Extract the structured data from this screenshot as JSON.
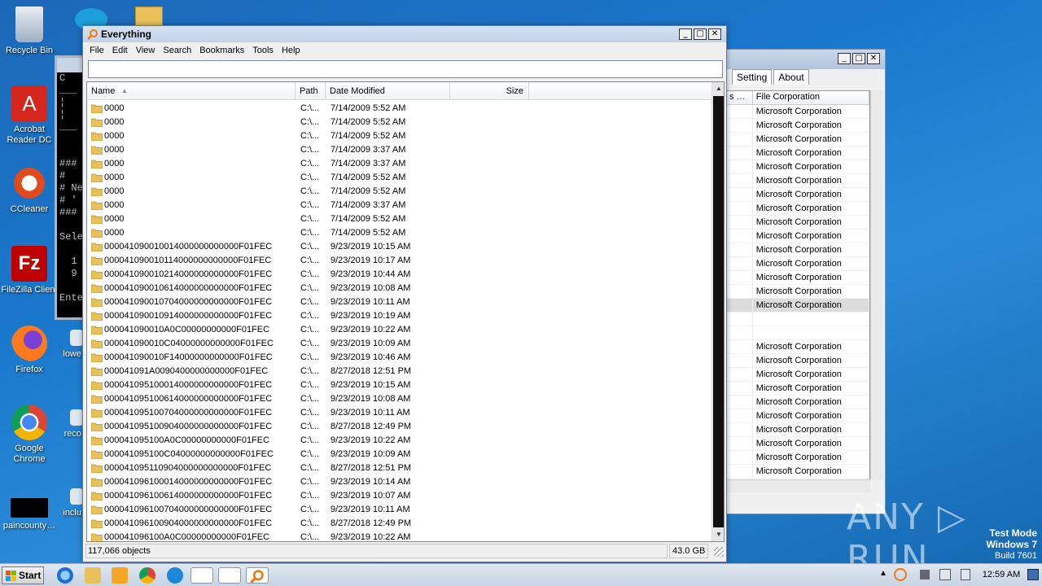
{
  "desktop": {
    "icons": [
      {
        "label": "Recycle Bin"
      },
      {
        "label": "Acrobat Reader DC"
      },
      {
        "label": "CCleaner"
      },
      {
        "label": "FileZilla Client"
      },
      {
        "label": "Firefox"
      },
      {
        "label": "Google Chrome"
      },
      {
        "label": "paincounty…"
      },
      {
        "label": "lowe"
      },
      {
        "label": "reco"
      },
      {
        "label": "inclu"
      }
    ]
  },
  "console": {
    "lines": [
      "C",
      "___",
      "¦",
      "¦",
      "___",
      "",
      "",
      "###",
      "#",
      "# Ne",
      "# '",
      "###",
      "",
      "Sele",
      "",
      "  1",
      "  9",
      "",
      "Ente"
    ]
  },
  "process_window": {
    "tabs": [
      "Setting",
      "About"
    ],
    "header": [
      "s …",
      "File Corporation"
    ],
    "rows_top": [
      "Microsoft Corporation",
      "Microsoft Corporation",
      "Microsoft Corporation",
      "Microsoft Corporation",
      "Microsoft Corporation",
      "Microsoft Corporation",
      "Microsoft Corporation",
      "Microsoft Corporation",
      "Microsoft Corporation",
      "Microsoft Corporation",
      "Microsoft Corporation",
      "Microsoft Corporation",
      "Microsoft Corporation",
      "Microsoft Corporation",
      "Microsoft Corporation"
    ],
    "rows_bottom": [
      "Microsoft Corporation",
      "Microsoft Corporation",
      "Microsoft Corporation",
      "Microsoft Corporation",
      "Microsoft Corporation",
      "Microsoft Corporation",
      "Microsoft Corporation",
      "Microsoft Corporation",
      "Microsoft Corporation",
      "Microsoft Corporation"
    ]
  },
  "everything": {
    "title": "Everything",
    "menu": [
      "File",
      "Edit",
      "View",
      "Search",
      "Bookmarks",
      "Tools",
      "Help"
    ],
    "search_value": "",
    "columns": {
      "name": "Name",
      "path": "Path",
      "date": "Date Modified",
      "size": "Size"
    },
    "rows": [
      {
        "name": "0000",
        "path": "C:\\...",
        "date": "7/14/2009 5:52 AM"
      },
      {
        "name": "0000",
        "path": "C:\\...",
        "date": "7/14/2009 5:52 AM"
      },
      {
        "name": "0000",
        "path": "C:\\...",
        "date": "7/14/2009 5:52 AM"
      },
      {
        "name": "0000",
        "path": "C:\\...",
        "date": "7/14/2009 3:37 AM"
      },
      {
        "name": "0000",
        "path": "C:\\...",
        "date": "7/14/2009 3:37 AM"
      },
      {
        "name": "0000",
        "path": "C:\\...",
        "date": "7/14/2009 5:52 AM"
      },
      {
        "name": "0000",
        "path": "C:\\...",
        "date": "7/14/2009 5:52 AM"
      },
      {
        "name": "0000",
        "path": "C:\\...",
        "date": "7/14/2009 3:37 AM"
      },
      {
        "name": "0000",
        "path": "C:\\...",
        "date": "7/14/2009 5:52 AM"
      },
      {
        "name": "0000",
        "path": "C:\\...",
        "date": "7/14/2009 5:52 AM"
      },
      {
        "name": "000041090010014000000000000F01FEC",
        "path": "C:\\...",
        "date": "9/23/2019 10:15 AM"
      },
      {
        "name": "000041090010114000000000000F01FEC",
        "path": "C:\\...",
        "date": "9/23/2019 10:17 AM"
      },
      {
        "name": "000041090010214000000000000F01FEC",
        "path": "C:\\...",
        "date": "9/23/2019 10:44 AM"
      },
      {
        "name": "000041090010614000000000000F01FEC",
        "path": "C:\\...",
        "date": "9/23/2019 10:08 AM"
      },
      {
        "name": "000041090010704000000000000F01FEC",
        "path": "C:\\...",
        "date": "9/23/2019 10:11 AM"
      },
      {
        "name": "000041090010914000000000000F01FEC",
        "path": "C:\\...",
        "date": "9/23/2019 10:19 AM"
      },
      {
        "name": "000041090010A0C00000000000F01FEC",
        "path": "C:\\...",
        "date": "9/23/2019 10:22 AM"
      },
      {
        "name": "000041090010C04000000000000F01FEC",
        "path": "C:\\...",
        "date": "9/23/2019 10:09 AM"
      },
      {
        "name": "000041090010F14000000000000F01FEC",
        "path": "C:\\...",
        "date": "9/23/2019 10:46 AM"
      },
      {
        "name": "000041091A0090400000000000F01FEC",
        "path": "C:\\...",
        "date": "8/27/2018 12:51 PM"
      },
      {
        "name": "000041095100014000000000000F01FEC",
        "path": "C:\\...",
        "date": "9/23/2019 10:15 AM"
      },
      {
        "name": "000041095100614000000000000F01FEC",
        "path": "C:\\...",
        "date": "9/23/2019 10:08 AM"
      },
      {
        "name": "000041095100704000000000000F01FEC",
        "path": "C:\\...",
        "date": "9/23/2019 10:11 AM"
      },
      {
        "name": "000041095100904000000000000F01FEC",
        "path": "C:\\...",
        "date": "8/27/2018 12:49 PM"
      },
      {
        "name": "000041095100A0C00000000000F01FEC",
        "path": "C:\\...",
        "date": "9/23/2019 10:22 AM"
      },
      {
        "name": "000041095100C04000000000000F01FEC",
        "path": "C:\\...",
        "date": "9/23/2019 10:09 AM"
      },
      {
        "name": "000041095110904000000000000F01FEC",
        "path": "C:\\...",
        "date": "8/27/2018 12:51 PM"
      },
      {
        "name": "000041096100014000000000000F01FEC",
        "path": "C:\\...",
        "date": "9/23/2019 10:14 AM"
      },
      {
        "name": "000041096100614000000000000F01FEC",
        "path": "C:\\...",
        "date": "9/23/2019 10:07 AM"
      },
      {
        "name": "000041096100704000000000000F01FEC",
        "path": "C:\\...",
        "date": "9/23/2019 10:11 AM"
      },
      {
        "name": "000041096100904000000000000F01FEC",
        "path": "C:\\...",
        "date": "8/27/2018 12:49 PM"
      },
      {
        "name": "000041096100A0C00000000000F01FEC",
        "path": "C:\\...",
        "date": "9/23/2019 10:22 AM"
      }
    ],
    "status_objects": "117,066 objects",
    "status_size": "43.0 GB"
  },
  "taskbar": {
    "start_label": "Start",
    "clock": "12:59 AM"
  },
  "watermark": {
    "brand": "ANY ▷ RUN"
  },
  "test_mode": {
    "line1": "Test Mode",
    "line2": "Windows 7",
    "line3": "Build 7601"
  },
  "colors": {
    "desktop": "#1a78cc",
    "titlebar": "#c0d1e8",
    "folder": "#e8c15a"
  }
}
